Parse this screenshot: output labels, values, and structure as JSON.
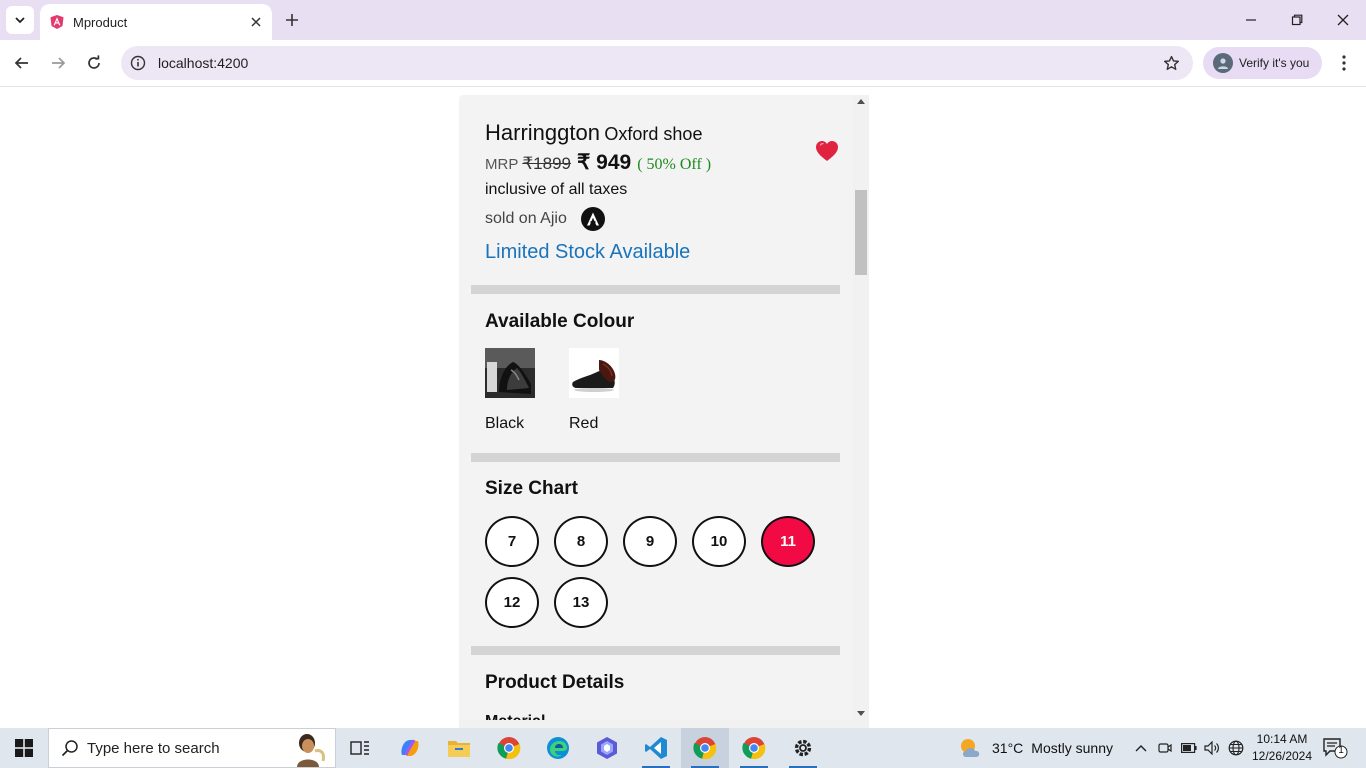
{
  "browser": {
    "tab_title": "Mproduct",
    "url": "localhost:4200",
    "profile_chip": "Verify it's you"
  },
  "product": {
    "brand": "Harringgton",
    "model": "Oxford shoe",
    "mrp_label": "MRP",
    "mrp_value": "₹1899",
    "price": "₹ 949",
    "discount": "( 50% Off )",
    "tax_note": "inclusive of all taxes",
    "sold_on": "sold on Ajio",
    "stock_status": "Limited Stock Available",
    "wishlist": true,
    "colors": {
      "title": "Available Colour",
      "options": [
        {
          "label": "Black"
        },
        {
          "label": "Red"
        }
      ]
    },
    "sizes": {
      "title": "Size Chart",
      "options": [
        "7",
        "8",
        "9",
        "10",
        "11",
        "12",
        "13"
      ],
      "selected": "11"
    },
    "details_title": "Product Details",
    "material_label": "Material"
  },
  "taskbar": {
    "search_placeholder": "Type here to search",
    "weather_temp": "31°C",
    "weather_desc": "Mostly sunny",
    "time": "10:14 AM",
    "date": "12/26/2024",
    "notifications": "1"
  },
  "colors": {
    "accent_selected": "#f20a45",
    "stock_link": "#1a74bb",
    "discount_green": "#1f8a1f"
  }
}
